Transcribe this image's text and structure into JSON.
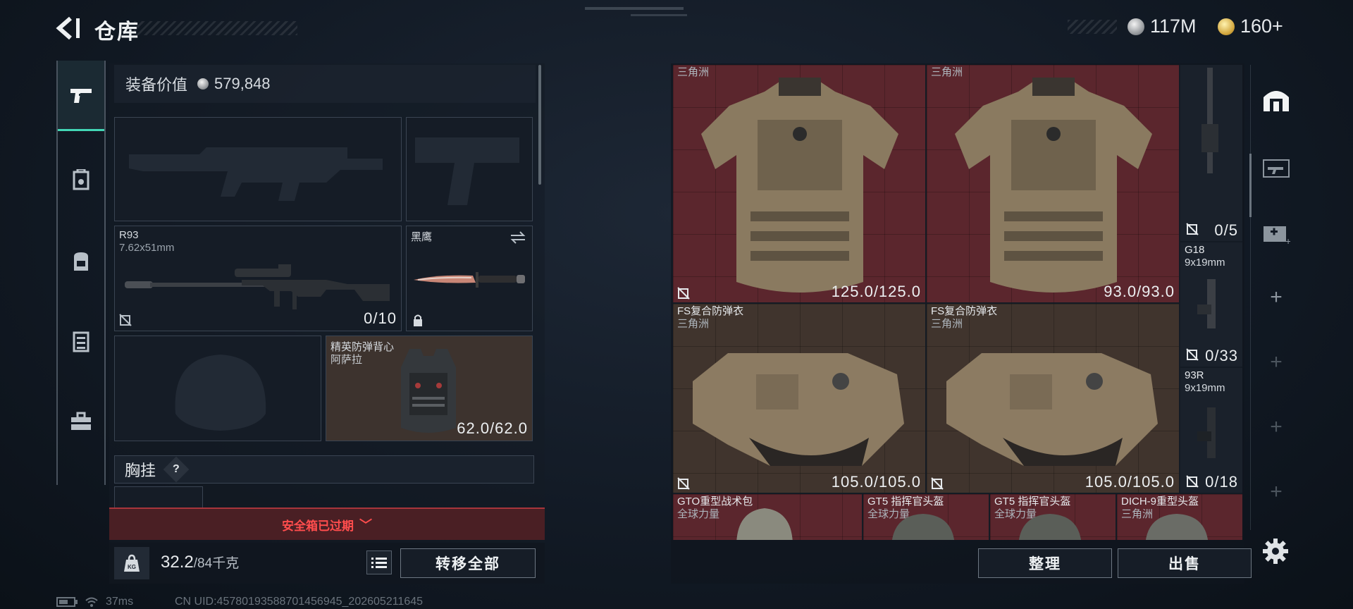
{
  "header": {
    "title": "仓库"
  },
  "currency": [
    {
      "type": "silver-coin",
      "value": "117M"
    },
    {
      "type": "gold-coin",
      "value": "160+"
    }
  ],
  "side_tabs": [
    {
      "icon": "pistol-icon",
      "active": true
    },
    {
      "icon": "armor-plate-icon",
      "active": false
    },
    {
      "icon": "backpack-icon",
      "active": false
    },
    {
      "icon": "chest-rig-icon",
      "active": false
    },
    {
      "icon": "toolbox-icon",
      "active": false
    }
  ],
  "loadout": {
    "value_label": "装备价值",
    "value": "579,848",
    "slots": {
      "sniper": {
        "name": "R93",
        "caliber": "7.62x51mm",
        "ammo": "0/10"
      },
      "melee": {
        "name": "黑鹰"
      },
      "armor": {
        "name": "精英防弹背心",
        "faction": "阿萨拉",
        "durability": "62.0/62.0"
      }
    },
    "chest_rig_label": "胸挂",
    "help_label": "?",
    "safe_box_status": "安全箱已过期",
    "weight_current": "32.2",
    "weight_capacity": "/84千克",
    "transfer_all_label": "转移全部"
  },
  "storage": {
    "items": [
      {
        "name": "",
        "faction": "三角洲",
        "durability": "125.0/125.0"
      },
      {
        "name": "",
        "faction": "三角洲",
        "durability": "93.0/93.0"
      },
      {
        "name": "FS复合防弹衣",
        "faction": "三角洲",
        "durability": "105.0/105.0"
      },
      {
        "name": "FS复合防弹衣",
        "faction": "三角洲",
        "durability": "105.0/105.0"
      },
      {
        "name": "GTO重型战术包",
        "faction": "全球力量"
      },
      {
        "name": "GT5 指挥官头盔",
        "faction": "全球力量"
      },
      {
        "name": "GT5 指挥官头盔",
        "faction": "全球力量"
      },
      {
        "name": "DICH-9重型头盔",
        "faction": "三角洲"
      }
    ],
    "weapons": [
      {
        "name": "",
        "caliber": "",
        "ammo": "0/5"
      },
      {
        "name": "G18",
        "caliber": "9x19mm",
        "ammo": "0/33"
      },
      {
        "name": "93R",
        "caliber": "9x19mm",
        "ammo": "0/18"
      }
    ],
    "sort_label": "整理",
    "sell_label": "出售"
  },
  "right_tabs": [
    {
      "icon": "vault-icon"
    },
    {
      "icon": "weapon-case-icon"
    },
    {
      "icon": "medical-case-icon"
    },
    {
      "icon": "add-icon"
    },
    {
      "icon": "add-icon"
    },
    {
      "icon": "add-icon"
    },
    {
      "icon": "add-icon"
    }
  ],
  "status": {
    "ping": "37ms",
    "uid": "CN UID:457801935887014569​45_202605211645"
  },
  "colors": {
    "accent": "#42d6b5",
    "warning": "#ff4d4d",
    "storage_red": "#5b262d",
    "storage_tan": "#40342d"
  }
}
